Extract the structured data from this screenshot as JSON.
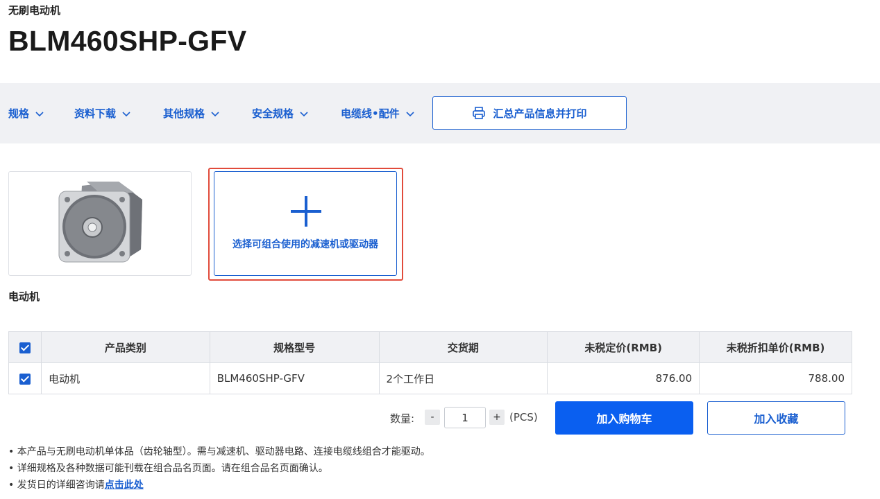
{
  "header": {
    "category": "无刷电动机",
    "title": "BLM460SHP-GFV"
  },
  "nav": {
    "items": [
      {
        "label": "规格"
      },
      {
        "label": "资料下载"
      },
      {
        "label": "其他规格"
      },
      {
        "label": "安全规格"
      },
      {
        "label": "电缆线•配件"
      }
    ],
    "print_label": "汇总产品信息并打印"
  },
  "colors": {
    "accent": "#1a5fd0",
    "primary_button": "#0a5ff0",
    "highlight_outline": "#e14b3b",
    "nav_background": "#f0f1f4"
  },
  "combo": {
    "select_label": "选择可组合使用的减速机或驱动器"
  },
  "section": {
    "label": "电动机"
  },
  "table": {
    "headers": [
      "产品类别",
      "规格型号",
      "交货期",
      "未税定价(RMB)",
      "未税折扣单价(RMB)"
    ],
    "rows": [
      {
        "category": "电动机",
        "model": "BLM460SHP-GFV",
        "delivery": "2个工作日",
        "list_price": "876.00",
        "unit_price": "788.00",
        "checked": true
      }
    ]
  },
  "quantity": {
    "label": "数量:",
    "value": "1",
    "minus": "-",
    "plus": "+",
    "unit": "(PCS)"
  },
  "actions": {
    "add_to_cart": "加入购物车",
    "add_to_favorites": "加入收藏"
  },
  "notes": {
    "line1": "• 本产品与无刷电动机单体品（齿轮轴型）。需与减速机、驱动器电路、连接电缆线组合才能驱动。",
    "line2": "• 详细规格及各种数据可能刊载在组合品名页面。请在组合品名页面确认。",
    "line3_prefix": "• 发货日的详细咨询请",
    "line3_link": "点击此处"
  }
}
